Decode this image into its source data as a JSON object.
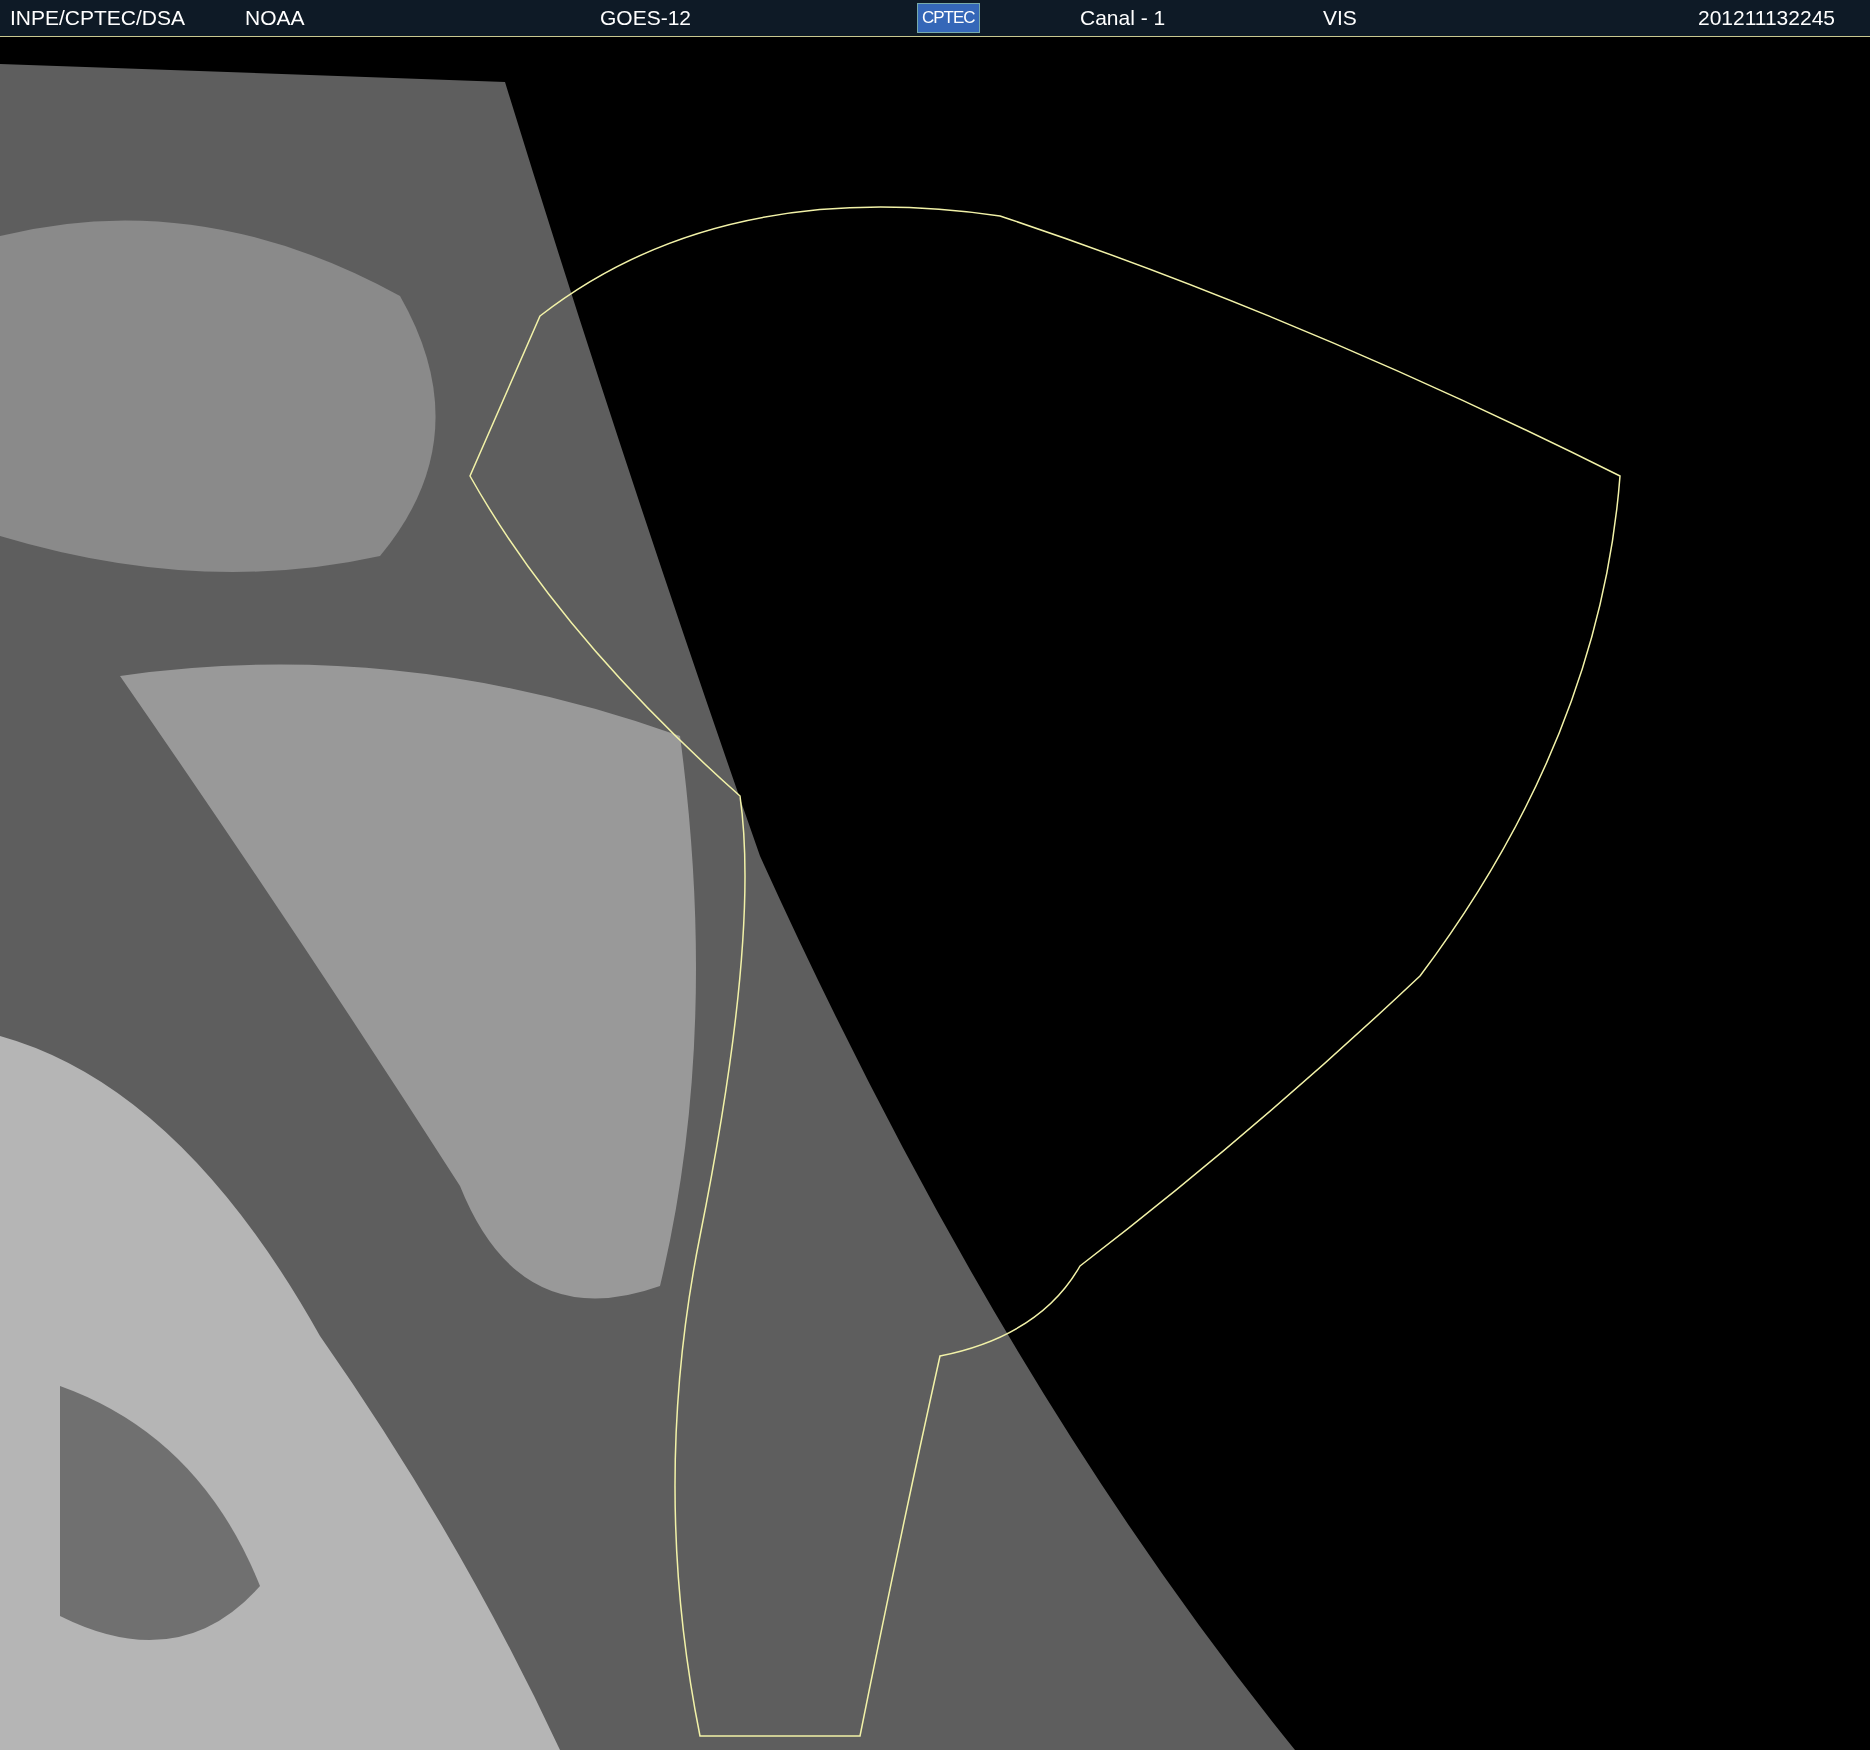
{
  "header": {
    "source": "INPE/CPTEC/DSA",
    "agency": "NOAA",
    "satellite": "GOES-12",
    "logo": "CPTEC",
    "channel": "Canal - 1",
    "band": "VIS",
    "timestamp": "201211132245"
  }
}
